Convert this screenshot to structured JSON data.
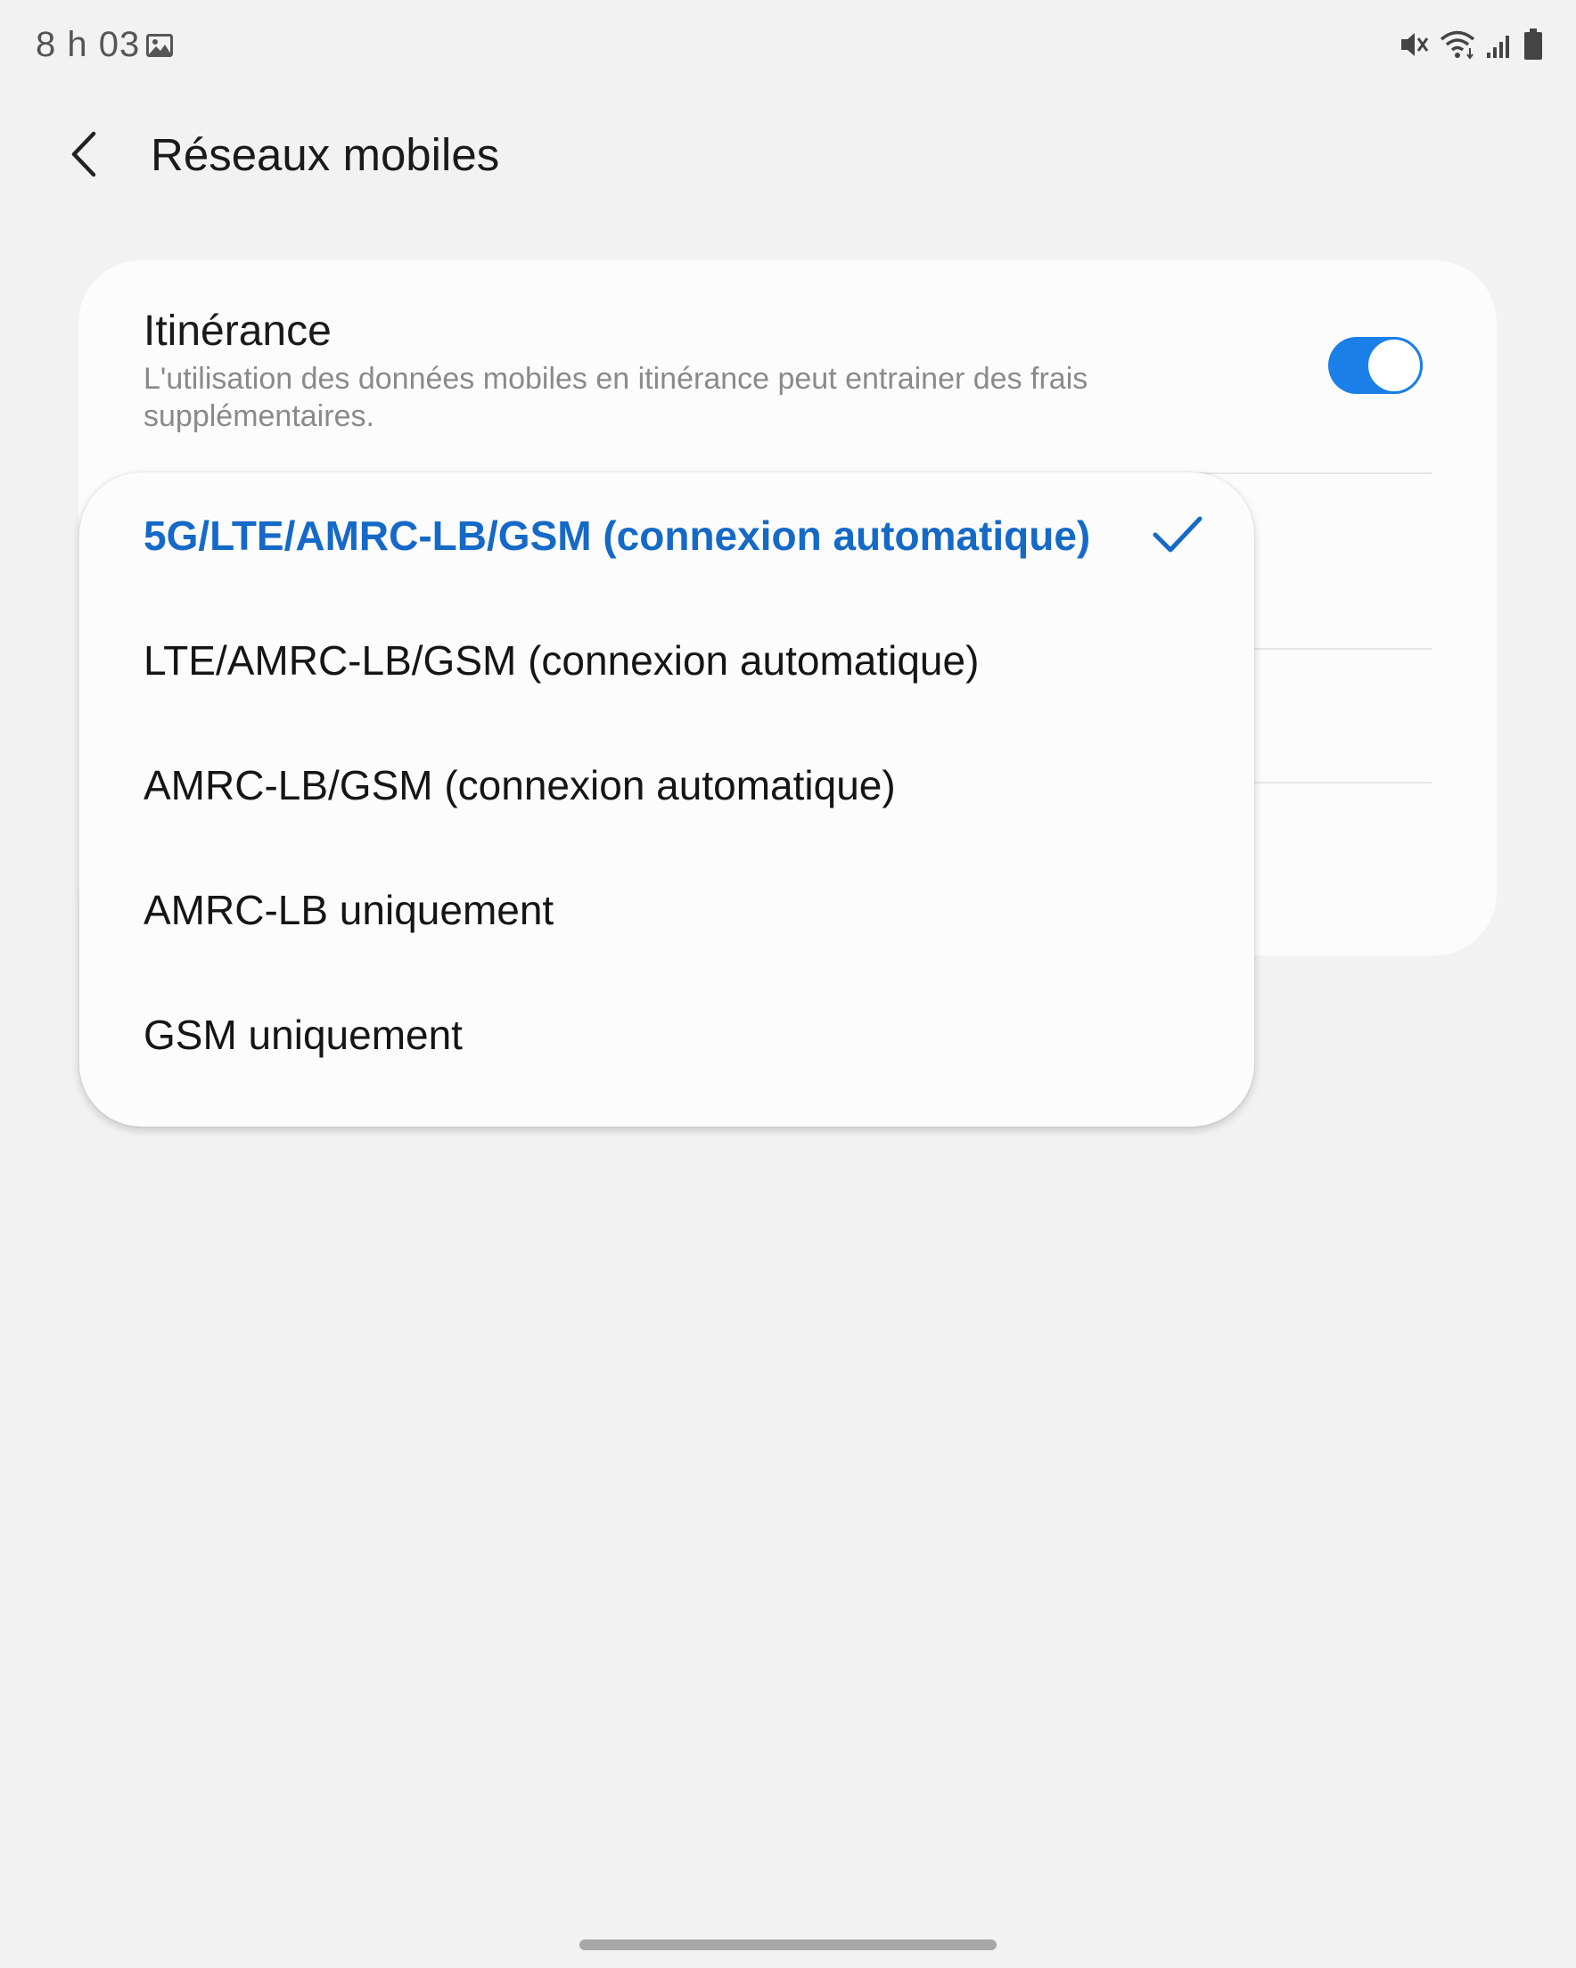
{
  "status_bar": {
    "time": "8 h 03",
    "icons": [
      "gallery-icon",
      "mute-icon",
      "wifi-icon",
      "signal-icon",
      "battery-icon"
    ]
  },
  "header": {
    "title": "Réseaux mobiles",
    "back_icon": "chevron-left-icon"
  },
  "settings": {
    "roaming": {
      "title": "Itinérance",
      "description": "L'utilisation des données mobiles en itinérance peut entrainer des frais supplémentaires.",
      "enabled": true
    }
  },
  "network_mode_menu": {
    "options": [
      {
        "label": "5G/LTE/AMRC-LB/GSM (connexion automatique)",
        "selected": true
      },
      {
        "label": "LTE/AMRC-LB/GSM (connexion automatique)",
        "selected": false
      },
      {
        "label": "AMRC-LB/GSM (connexion automatique)",
        "selected": false
      },
      {
        "label": "AMRC-LB uniquement",
        "selected": false
      },
      {
        "label": "GSM uniquement",
        "selected": false
      }
    ],
    "check_icon": "checkmark-icon"
  },
  "colors": {
    "accent": "#1a7fe8",
    "selected_text": "#1569c7",
    "background": "#f2f2f2",
    "card": "#fcfcfc"
  }
}
